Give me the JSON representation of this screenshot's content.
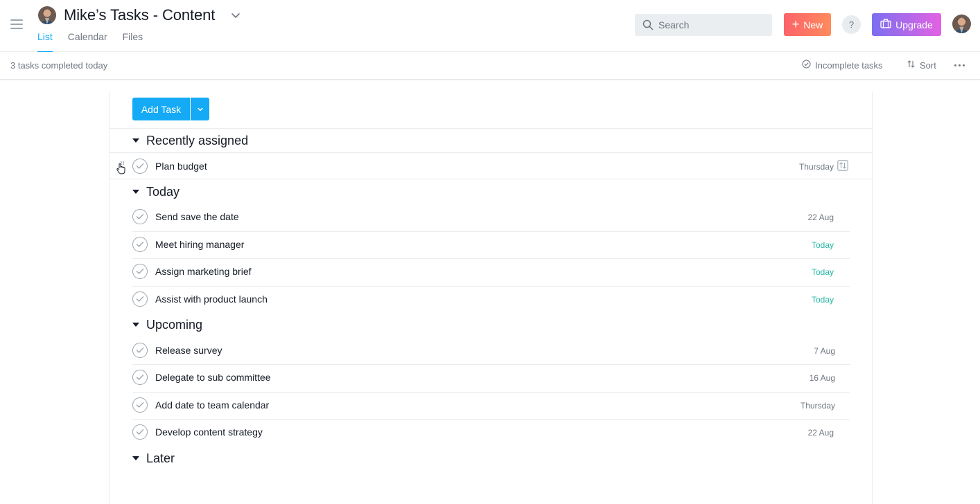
{
  "header": {
    "project_title": "Mike’s Tasks - Content",
    "tabs": [
      {
        "label": "List",
        "active": true
      },
      {
        "label": "Calendar",
        "active": false
      },
      {
        "label": "Files",
        "active": false
      }
    ],
    "search_placeholder": "Search",
    "new_label": "New",
    "help_label": "?",
    "upgrade_label": "Upgrade"
  },
  "subbar": {
    "completed_text": "3 tasks completed today",
    "filter_label": "Incomplete tasks",
    "sort_label": "Sort"
  },
  "toolbar": {
    "add_task_label": "Add Task"
  },
  "sections": [
    {
      "title": "Recently assigned",
      "tasks": [
        {
          "name": "Plan budget",
          "due": "Thursday",
          "due_today": false
        }
      ]
    },
    {
      "title": "Today",
      "tasks": [
        {
          "name": "Send save the date",
          "due": "22 Aug",
          "due_today": false
        },
        {
          "name": "Meet hiring manager",
          "due": "Today",
          "due_today": true
        },
        {
          "name": "Assign marketing brief",
          "due": "Today",
          "due_today": true
        },
        {
          "name": "Assist with product launch",
          "due": "Today",
          "due_today": true
        }
      ]
    },
    {
      "title": "Upcoming",
      "tasks": [
        {
          "name": "Release survey",
          "due": "7 Aug",
          "due_today": false
        },
        {
          "name": "Delegate to sub committee",
          "due": "16 Aug",
          "due_today": false
        },
        {
          "name": "Add date to team calendar",
          "due": "Thursday",
          "due_today": false
        },
        {
          "name": "Develop content strategy",
          "due": "22 Aug",
          "due_today": false
        }
      ]
    },
    {
      "title": "Later",
      "tasks": []
    }
  ],
  "colors": {
    "accent": "#14aaf5",
    "today_green": "#25b8a3",
    "new_gradient_start": "#fc636b",
    "upgrade_gradient_start": "#7a6ff0"
  },
  "icons": [
    "hamburger-icon",
    "chevron-down-icon",
    "search-icon",
    "plus-icon",
    "briefcase-icon",
    "check-circle-icon",
    "sort-icon",
    "more-icon",
    "drag-handle-icon",
    "subtask-icon",
    "checkmark-icon",
    "triangle-down-icon"
  ]
}
